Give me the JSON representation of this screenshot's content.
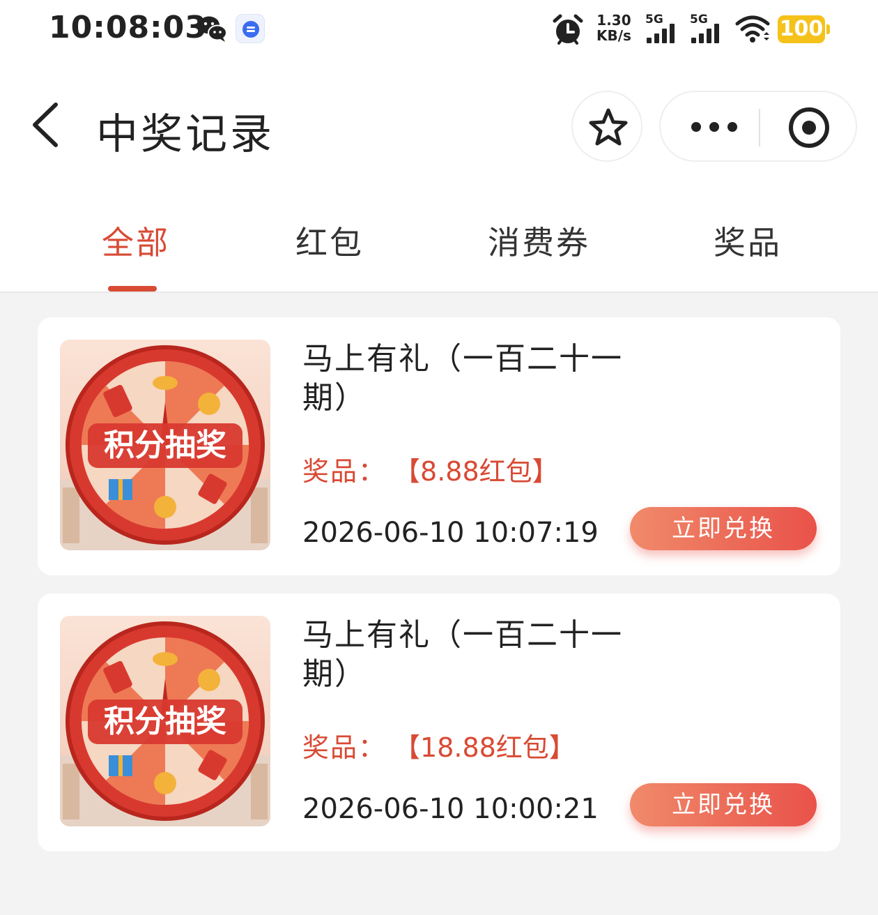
{
  "status_bar": {
    "time": "10:08:03",
    "net_speed_value": "1.30",
    "net_speed_unit": "KB/s",
    "signal1_label": "5G",
    "signal2_label": "5G",
    "battery": "100",
    "icons": [
      "wechat-icon",
      "message-app-icon",
      "alarm-icon",
      "signal-icon",
      "wifi-icon",
      "battery-icon"
    ]
  },
  "nav": {
    "title": "中奖记录",
    "icons": [
      "back-arrow-icon",
      "star-icon",
      "more-dots-icon",
      "target-icon"
    ]
  },
  "tabs": [
    {
      "label": "全部",
      "active": true
    },
    {
      "label": "红包",
      "active": false
    },
    {
      "label": "消费券",
      "active": false
    },
    {
      "label": "奖品",
      "active": false
    }
  ],
  "records": [
    {
      "title": "马上有礼（一百二十一期）",
      "prize_label": "奖品：",
      "prize_value": "【8.88红包】",
      "datetime": "2026-06-10 10:07:19",
      "button": "立即兑换",
      "thumb_text": "积分抽奖"
    },
    {
      "title": "马上有礼（一百二十一期）",
      "prize_label": "奖品：",
      "prize_value": "【18.88红包】",
      "datetime": "2026-06-10 10:00:21",
      "button": "立即兑换",
      "thumb_text": "积分抽奖"
    }
  ],
  "colors": {
    "accent": "#d84a34",
    "button_gradient_start": "#f08a6a",
    "button_gradient_end": "#e9524a",
    "battery": "#f5c21b",
    "background": "#f3f3f3"
  }
}
